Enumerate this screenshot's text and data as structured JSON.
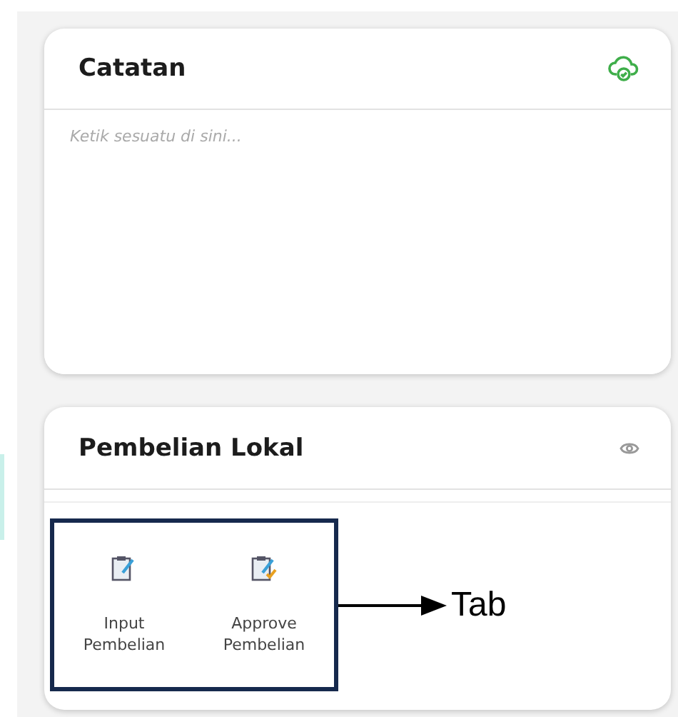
{
  "notes_card": {
    "title": "Catatan",
    "placeholder": "Ketik sesuatu di sini..."
  },
  "purchase_card": {
    "title": "Pembelian Lokal",
    "tiles": [
      {
        "kind": "input",
        "label": "Input Pembelian"
      },
      {
        "kind": "approve",
        "label": "Approve Pembelian"
      }
    ]
  },
  "annotation": {
    "label": "Tab"
  }
}
